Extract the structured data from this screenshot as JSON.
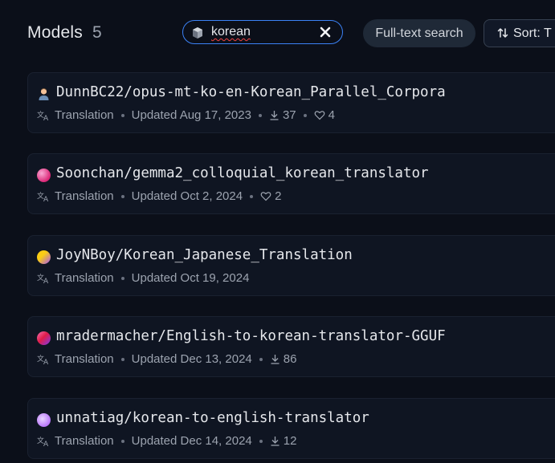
{
  "header": {
    "title": "Models",
    "count": "5",
    "search": {
      "value": "korean"
    },
    "fulltext_label": "Full-text search",
    "sort_label": "Sort:  T"
  },
  "models": [
    {
      "name": "DunnBC22/opus-mt-ko-en-Korean_Parallel_Corpora",
      "task": "Translation",
      "updated": "Updated Aug 17, 2023",
      "downloads": "37",
      "likes": "4",
      "avatar": "person"
    },
    {
      "name": "Soonchan/gemma2_colloquial_korean_translator",
      "task": "Translation",
      "updated": "Updated Oct 2, 2024",
      "downloads": null,
      "likes": "2",
      "avatar": "gradient-pink"
    },
    {
      "name": "JoyNBoy/Korean_Japanese_Translation",
      "task": "Translation",
      "updated": "Updated Oct 19, 2024",
      "downloads": null,
      "likes": null,
      "avatar": "gradient-yellow"
    },
    {
      "name": "mradermacher/English-to-korean-translator-GGUF",
      "task": "Translation",
      "updated": "Updated Dec 13, 2024",
      "downloads": "86",
      "likes": null,
      "avatar": "gradient-rose"
    },
    {
      "name": "unnatiag/korean-to-english-translator",
      "task": "Translation",
      "updated": "Updated Dec 14, 2024",
      "downloads": "12",
      "likes": null,
      "avatar": "gradient-violet"
    }
  ],
  "colors": {
    "background": "#0b0f19",
    "card": "#0f1522",
    "search_border": "#3b82f6",
    "text": "#e5e7eb",
    "muted": "#9ca3af"
  }
}
